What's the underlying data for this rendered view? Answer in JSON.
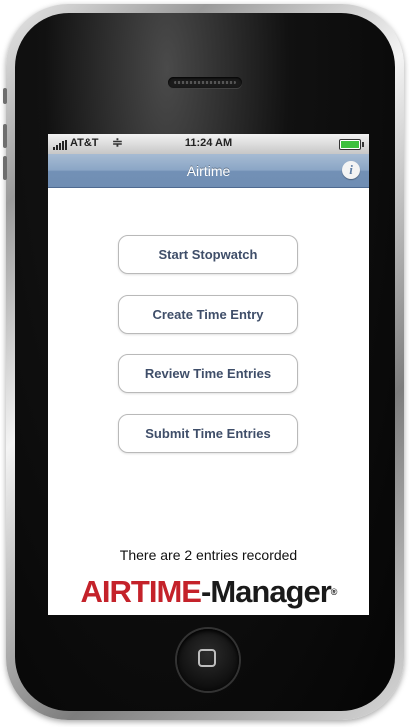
{
  "status_bar": {
    "carrier": "AT&T",
    "time": "11:24 AM",
    "wifi_icon": "wifi-icon",
    "battery_icon": "battery-icon"
  },
  "nav_bar": {
    "title": "Airtime",
    "info_label": "i"
  },
  "menu": {
    "buttons": [
      {
        "label": "Start Stopwatch"
      },
      {
        "label": "Create Time Entry"
      },
      {
        "label": "Review Time Entries"
      },
      {
        "label": "Submit Time Entries"
      }
    ]
  },
  "footer": {
    "entries_text": "There are 2 entries recorded"
  },
  "logo": {
    "part1": "AIRTIME",
    "separator": "-",
    "part2": "Manager",
    "mark": "®"
  },
  "colors": {
    "nav_bar": "#7d9ac0",
    "logo_red": "#c4222a",
    "button_text": "#3f4e69"
  }
}
